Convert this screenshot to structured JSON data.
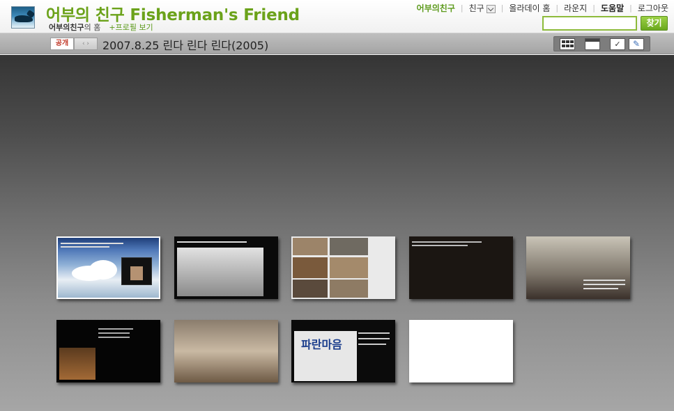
{
  "header": {
    "site_title": "어부의 친구 Fisherman's Friend",
    "owner_name": "어부의친구",
    "owner_suffix": "의 홈",
    "profile_link": "+프로필 보기",
    "search_placeholder": "",
    "search_button": "찾기"
  },
  "topnav": {
    "home": "어부의친구",
    "friends": "친구",
    "allday_home": "올라데이 홈",
    "lounge": "라운지",
    "help": "도움말",
    "logout": "로그아웃"
  },
  "titlebar": {
    "visibility": "공개",
    "album_title": "2007.8.25 린다 린다 린다(2005)"
  },
  "icons": {
    "logo": "whale-logo-icon",
    "friends_dropdown": "chevron-down-icon",
    "grid_view": "grid-view-icon",
    "calendar_view": "calendar-view-icon",
    "check_view": "check-icon",
    "edit_view": "edit-icon"
  },
  "colors": {
    "brand_green": "#6ba21a",
    "link_green": "#5c9a1b",
    "public_red": "#c23a2a"
  },
  "thumbnails": [
    {
      "id": "thumb-1",
      "selected": true
    },
    {
      "id": "thumb-2",
      "selected": false
    },
    {
      "id": "thumb-3",
      "selected": false
    },
    {
      "id": "thumb-4",
      "selected": false
    },
    {
      "id": "thumb-5",
      "selected": false
    },
    {
      "id": "thumb-6",
      "selected": false
    },
    {
      "id": "thumb-7",
      "selected": false
    },
    {
      "id": "thumb-8",
      "selected": false
    },
    {
      "id": "thumb-9",
      "selected": false
    }
  ]
}
